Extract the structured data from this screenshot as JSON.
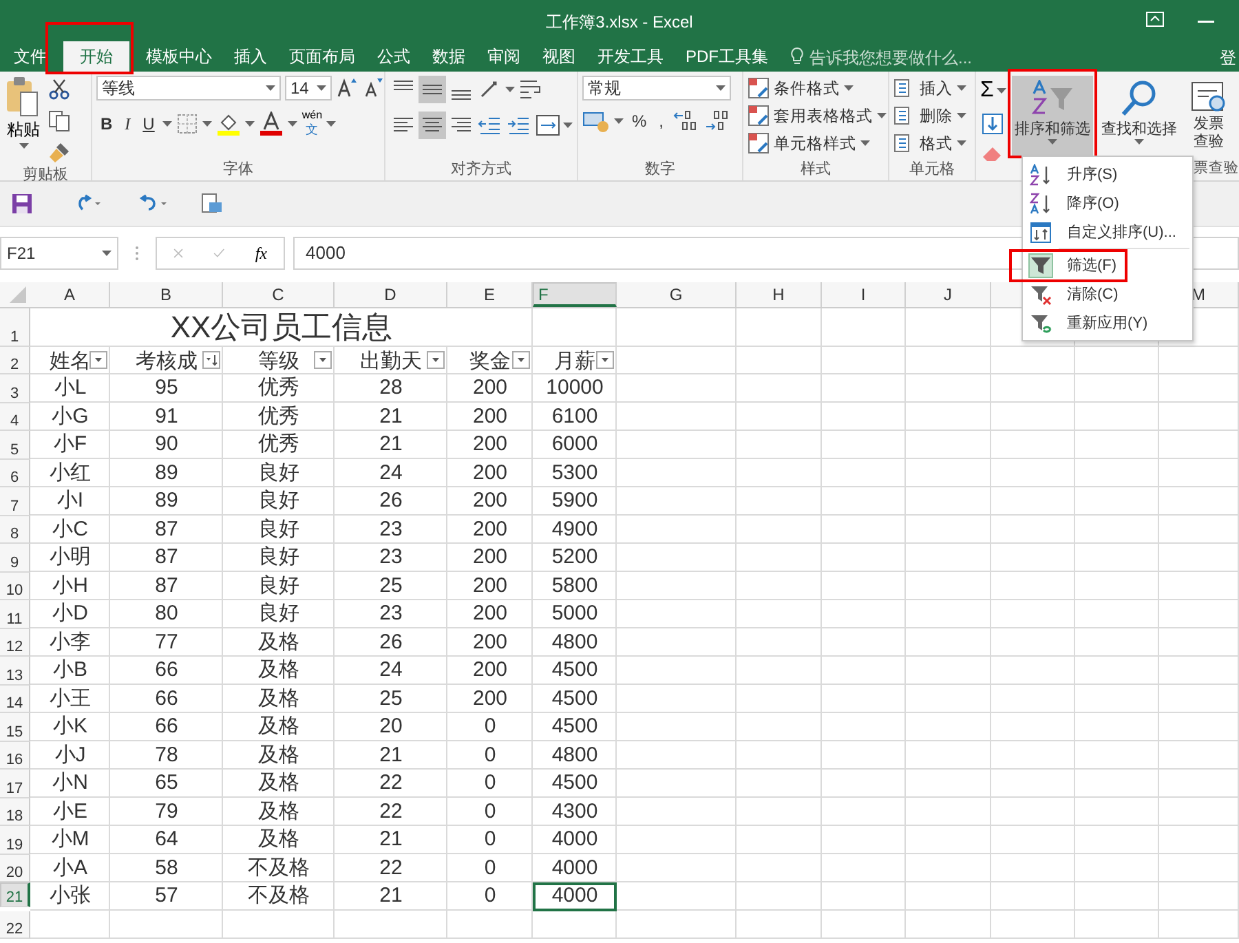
{
  "window": {
    "title": "工作簿3.xlsx - Excel"
  },
  "tabs": [
    {
      "label": "文件",
      "selected": false,
      "outlined": false
    },
    {
      "label": "开始",
      "selected": true,
      "outlined": true
    },
    {
      "label": "模板中心",
      "selected": false,
      "outlined": false
    },
    {
      "label": "插入",
      "selected": false,
      "outlined": false
    },
    {
      "label": "页面布局",
      "selected": false,
      "outlined": false
    },
    {
      "label": "公式",
      "selected": false,
      "outlined": false
    },
    {
      "label": "数据",
      "selected": false,
      "outlined": false
    },
    {
      "label": "审阅",
      "selected": false,
      "outlined": false
    },
    {
      "label": "视图",
      "selected": false,
      "outlined": false
    },
    {
      "label": "开发工具",
      "selected": false,
      "outlined": false
    },
    {
      "label": "PDF工具集",
      "selected": false,
      "outlined": false
    }
  ],
  "tell_me": {
    "placeholder": "告诉我您想要做什么..."
  },
  "account": "登",
  "ribbon": {
    "clipboard": {
      "paste": "粘贴",
      "label": "剪贴板"
    },
    "font": {
      "name": "等线",
      "size": "14",
      "bold": "B",
      "italic": "I",
      "underline": "U",
      "phonetic": "wén",
      "phonetic_char": "文",
      "label": "字体"
    },
    "alignment": {
      "label": "对齐方式"
    },
    "number": {
      "format": "常规",
      "percent": "%",
      "comma": ",",
      "label": "数字"
    },
    "styles": {
      "items": [
        "条件格式",
        "套用表格格式",
        "单元格样式"
      ],
      "label": "样式"
    },
    "cells": {
      "items": [
        "插入",
        "删除",
        "格式"
      ],
      "label": "单元格"
    },
    "editing": {
      "sum": "Σ",
      "sort_filter": {
        "label": "排序和筛选",
        "outlined": true,
        "expanded": true
      },
      "find": "查找和选择"
    },
    "invoice": {
      "lines": [
        "发票",
        "查验"
      ],
      "label": "票查验"
    }
  },
  "sort_menu": {
    "items": [
      {
        "kind": "asc",
        "label": "升序(S)",
        "checked": false,
        "outlined": false
      },
      {
        "kind": "desc",
        "label": "降序(O)",
        "checked": false,
        "outlined": false
      },
      {
        "kind": "custom",
        "label": "自定义排序(U)...",
        "checked": false,
        "outlined": false
      },
      {
        "kind": "filter",
        "label": "筛选(F)",
        "checked": true,
        "outlined": true
      },
      {
        "kind": "clear",
        "label": "清除(C)",
        "checked": false,
        "outlined": false
      },
      {
        "kind": "reapply",
        "label": "重新应用(Y)",
        "checked": false,
        "outlined": false
      }
    ]
  },
  "name_box": "F21",
  "formula": {
    "fx": "fx",
    "value": "4000"
  },
  "sheet": {
    "columns": [
      {
        "label": "A",
        "selected": false
      },
      {
        "label": "B",
        "selected": false
      },
      {
        "label": "C",
        "selected": false
      },
      {
        "label": "D",
        "selected": false
      },
      {
        "label": "E",
        "selected": false
      },
      {
        "label": "F",
        "selected": true
      },
      {
        "label": "G",
        "selected": false
      },
      {
        "label": "H",
        "selected": false
      },
      {
        "label": "I",
        "selected": false
      },
      {
        "label": "J",
        "selected": false
      },
      {
        "label": "M",
        "selected": false
      }
    ],
    "title_row": {
      "number": "1",
      "text": "XX公司员工信息"
    },
    "header_row": {
      "number": "2",
      "cells": [
        {
          "label": "姓名",
          "kind": "filter"
        },
        {
          "label": "考核成",
          "kind": "sorted"
        },
        {
          "label": "等级",
          "kind": "filter"
        },
        {
          "label": "出勤天",
          "kind": "filter"
        },
        {
          "label": "奖金",
          "kind": "filter"
        },
        {
          "label": "月薪",
          "kind": "filter"
        }
      ]
    },
    "rows": [
      {
        "number": "3",
        "selected": false,
        "cells": [
          "小L",
          "95",
          "优秀",
          "28",
          "200",
          "10000"
        ]
      },
      {
        "number": "4",
        "selected": false,
        "cells": [
          "小G",
          "91",
          "优秀",
          "21",
          "200",
          "6100"
        ]
      },
      {
        "number": "5",
        "selected": false,
        "cells": [
          "小F",
          "90",
          "优秀",
          "21",
          "200",
          "6000"
        ]
      },
      {
        "number": "6",
        "selected": false,
        "cells": [
          "小红",
          "89",
          "良好",
          "24",
          "200",
          "5300"
        ]
      },
      {
        "number": "7",
        "selected": false,
        "cells": [
          "小I",
          "89",
          "良好",
          "26",
          "200",
          "5900"
        ]
      },
      {
        "number": "8",
        "selected": false,
        "cells": [
          "小C",
          "87",
          "良好",
          "23",
          "200",
          "4900"
        ]
      },
      {
        "number": "9",
        "selected": false,
        "cells": [
          "小明",
          "87",
          "良好",
          "23",
          "200",
          "5200"
        ]
      },
      {
        "number": "10",
        "selected": false,
        "cells": [
          "小H",
          "87",
          "良好",
          "25",
          "200",
          "5800"
        ]
      },
      {
        "number": "11",
        "selected": false,
        "cells": [
          "小D",
          "80",
          "良好",
          "23",
          "200",
          "5000"
        ]
      },
      {
        "number": "12",
        "selected": false,
        "cells": [
          "小李",
          "77",
          "及格",
          "26",
          "200",
          "4800"
        ]
      },
      {
        "number": "13",
        "selected": false,
        "cells": [
          "小B",
          "66",
          "及格",
          "24",
          "200",
          "4500"
        ]
      },
      {
        "number": "14",
        "selected": false,
        "cells": [
          "小王",
          "66",
          "及格",
          "25",
          "200",
          "4500"
        ]
      },
      {
        "number": "15",
        "selected": false,
        "cells": [
          "小K",
          "66",
          "及格",
          "20",
          "0",
          "4500"
        ]
      },
      {
        "number": "16",
        "selected": false,
        "cells": [
          "小J",
          "78",
          "及格",
          "21",
          "0",
          "4800"
        ]
      },
      {
        "number": "17",
        "selected": false,
        "cells": [
          "小N",
          "65",
          "及格",
          "22",
          "0",
          "4500"
        ]
      },
      {
        "number": "18",
        "selected": false,
        "cells": [
          "小E",
          "79",
          "及格",
          "22",
          "0",
          "4300"
        ]
      },
      {
        "number": "19",
        "selected": false,
        "cells": [
          "小M",
          "64",
          "及格",
          "21",
          "0",
          "4000"
        ]
      },
      {
        "number": "20",
        "selected": false,
        "cells": [
          "小A",
          "58",
          "不及格",
          "22",
          "0",
          "4000"
        ]
      },
      {
        "number": "21",
        "selected": true,
        "cells": [
          "小张",
          "57",
          "不及格",
          "21",
          "0",
          "4000"
        ]
      },
      {
        "number": "22",
        "selected": false,
        "cells": []
      }
    ]
  }
}
